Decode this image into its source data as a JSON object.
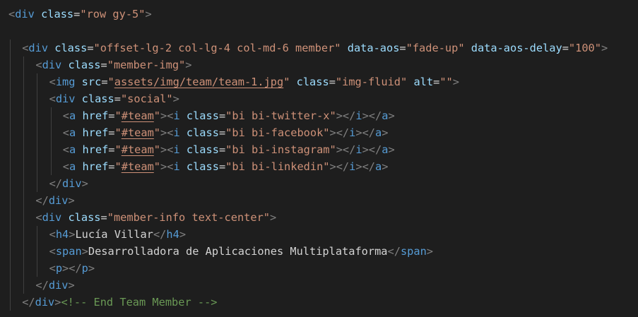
{
  "editor": {
    "theme": {
      "background": "#1e1e1e",
      "tag": "#569cd6",
      "bracket": "#808080",
      "attribute": "#9cdcfe",
      "string": "#ce9178",
      "text": "#d4d4d4",
      "comment": "#6a9955",
      "indent_guide": "#404040"
    },
    "lines": [
      {
        "indent": 0,
        "tokens": [
          {
            "t": "punc",
            "v": "<"
          },
          {
            "t": "tag",
            "v": "div"
          },
          {
            "t": "text",
            "v": " "
          },
          {
            "t": "attr",
            "v": "class"
          },
          {
            "t": "text",
            "v": "="
          },
          {
            "t": "str",
            "v": "\"row gy-5\""
          },
          {
            "t": "punc",
            "v": ">"
          }
        ]
      },
      {
        "indent": 0,
        "tokens": []
      },
      {
        "indent": 1,
        "tokens": [
          {
            "t": "punc",
            "v": "<"
          },
          {
            "t": "tag",
            "v": "div"
          },
          {
            "t": "text",
            "v": " "
          },
          {
            "t": "attr",
            "v": "class"
          },
          {
            "t": "text",
            "v": "="
          },
          {
            "t": "str",
            "v": "\"offset-lg-2 col-lg-4 col-md-6 member\""
          },
          {
            "t": "text",
            "v": " "
          },
          {
            "t": "attr",
            "v": "data-aos"
          },
          {
            "t": "text",
            "v": "="
          },
          {
            "t": "str",
            "v": "\"fade-up\""
          },
          {
            "t": "text",
            "v": " "
          },
          {
            "t": "attr",
            "v": "data-aos-delay"
          },
          {
            "t": "text",
            "v": "="
          },
          {
            "t": "str",
            "v": "\"100\""
          },
          {
            "t": "punc",
            "v": ">"
          }
        ]
      },
      {
        "indent": 2,
        "tokens": [
          {
            "t": "punc",
            "v": "<"
          },
          {
            "t": "tag",
            "v": "div"
          },
          {
            "t": "text",
            "v": " "
          },
          {
            "t": "attr",
            "v": "class"
          },
          {
            "t": "text",
            "v": "="
          },
          {
            "t": "str",
            "v": "\"member-img\""
          },
          {
            "t": "punc",
            "v": ">"
          }
        ]
      },
      {
        "indent": 3,
        "tokens": [
          {
            "t": "punc",
            "v": "<"
          },
          {
            "t": "tag",
            "v": "img"
          },
          {
            "t": "text",
            "v": " "
          },
          {
            "t": "attr",
            "v": "src"
          },
          {
            "t": "text",
            "v": "="
          },
          {
            "t": "str",
            "v": "\""
          },
          {
            "t": "str",
            "v": "assets/img/team/team-1.jpg",
            "link": true
          },
          {
            "t": "str",
            "v": "\""
          },
          {
            "t": "text",
            "v": " "
          },
          {
            "t": "attr",
            "v": "class"
          },
          {
            "t": "text",
            "v": "="
          },
          {
            "t": "str",
            "v": "\"img-fluid\""
          },
          {
            "t": "text",
            "v": " "
          },
          {
            "t": "attr",
            "v": "alt"
          },
          {
            "t": "text",
            "v": "="
          },
          {
            "t": "str",
            "v": "\"\""
          },
          {
            "t": "punc",
            "v": ">"
          }
        ]
      },
      {
        "indent": 3,
        "tokens": [
          {
            "t": "punc",
            "v": "<"
          },
          {
            "t": "tag",
            "v": "div"
          },
          {
            "t": "text",
            "v": " "
          },
          {
            "t": "attr",
            "v": "class"
          },
          {
            "t": "text",
            "v": "="
          },
          {
            "t": "str",
            "v": "\"social\""
          },
          {
            "t": "punc",
            "v": ">"
          }
        ]
      },
      {
        "indent": 4,
        "tokens": [
          {
            "t": "punc",
            "v": "<"
          },
          {
            "t": "tag",
            "v": "a"
          },
          {
            "t": "text",
            "v": " "
          },
          {
            "t": "attr",
            "v": "href"
          },
          {
            "t": "text",
            "v": "="
          },
          {
            "t": "str",
            "v": "\""
          },
          {
            "t": "str",
            "v": "#team",
            "link": true
          },
          {
            "t": "str",
            "v": "\""
          },
          {
            "t": "punc",
            "v": "><"
          },
          {
            "t": "tag",
            "v": "i"
          },
          {
            "t": "text",
            "v": " "
          },
          {
            "t": "attr",
            "v": "class"
          },
          {
            "t": "text",
            "v": "="
          },
          {
            "t": "str",
            "v": "\"bi bi-twitter-x\""
          },
          {
            "t": "punc",
            "v": "></"
          },
          {
            "t": "tag",
            "v": "i"
          },
          {
            "t": "punc",
            "v": "></"
          },
          {
            "t": "tag",
            "v": "a"
          },
          {
            "t": "punc",
            "v": ">"
          }
        ]
      },
      {
        "indent": 4,
        "tokens": [
          {
            "t": "punc",
            "v": "<"
          },
          {
            "t": "tag",
            "v": "a"
          },
          {
            "t": "text",
            "v": " "
          },
          {
            "t": "attr",
            "v": "href"
          },
          {
            "t": "text",
            "v": "="
          },
          {
            "t": "str",
            "v": "\""
          },
          {
            "t": "str",
            "v": "#team",
            "link": true
          },
          {
            "t": "str",
            "v": "\""
          },
          {
            "t": "punc",
            "v": "><"
          },
          {
            "t": "tag",
            "v": "i"
          },
          {
            "t": "text",
            "v": " "
          },
          {
            "t": "attr",
            "v": "class"
          },
          {
            "t": "text",
            "v": "="
          },
          {
            "t": "str",
            "v": "\"bi bi-facebook\""
          },
          {
            "t": "punc",
            "v": "></"
          },
          {
            "t": "tag",
            "v": "i"
          },
          {
            "t": "punc",
            "v": "></"
          },
          {
            "t": "tag",
            "v": "a"
          },
          {
            "t": "punc",
            "v": ">"
          }
        ]
      },
      {
        "indent": 4,
        "tokens": [
          {
            "t": "punc",
            "v": "<"
          },
          {
            "t": "tag",
            "v": "a"
          },
          {
            "t": "text",
            "v": " "
          },
          {
            "t": "attr",
            "v": "href"
          },
          {
            "t": "text",
            "v": "="
          },
          {
            "t": "str",
            "v": "\""
          },
          {
            "t": "str",
            "v": "#team",
            "link": true
          },
          {
            "t": "str",
            "v": "\""
          },
          {
            "t": "punc",
            "v": "><"
          },
          {
            "t": "tag",
            "v": "i"
          },
          {
            "t": "text",
            "v": " "
          },
          {
            "t": "attr",
            "v": "class"
          },
          {
            "t": "text",
            "v": "="
          },
          {
            "t": "str",
            "v": "\"bi bi-instagram\""
          },
          {
            "t": "punc",
            "v": "></"
          },
          {
            "t": "tag",
            "v": "i"
          },
          {
            "t": "punc",
            "v": "></"
          },
          {
            "t": "tag",
            "v": "a"
          },
          {
            "t": "punc",
            "v": ">"
          }
        ]
      },
      {
        "indent": 4,
        "tokens": [
          {
            "t": "punc",
            "v": "<"
          },
          {
            "t": "tag",
            "v": "a"
          },
          {
            "t": "text",
            "v": " "
          },
          {
            "t": "attr",
            "v": "href"
          },
          {
            "t": "text",
            "v": "="
          },
          {
            "t": "str",
            "v": "\""
          },
          {
            "t": "str",
            "v": "#team",
            "link": true
          },
          {
            "t": "str",
            "v": "\""
          },
          {
            "t": "punc",
            "v": "><"
          },
          {
            "t": "tag",
            "v": "i"
          },
          {
            "t": "text",
            "v": " "
          },
          {
            "t": "attr",
            "v": "class"
          },
          {
            "t": "text",
            "v": "="
          },
          {
            "t": "str",
            "v": "\"bi bi-linkedin\""
          },
          {
            "t": "punc",
            "v": "></"
          },
          {
            "t": "tag",
            "v": "i"
          },
          {
            "t": "punc",
            "v": "></"
          },
          {
            "t": "tag",
            "v": "a"
          },
          {
            "t": "punc",
            "v": ">"
          }
        ]
      },
      {
        "indent": 3,
        "tokens": [
          {
            "t": "punc",
            "v": "</"
          },
          {
            "t": "tag",
            "v": "div"
          },
          {
            "t": "punc",
            "v": ">"
          }
        ]
      },
      {
        "indent": 2,
        "tokens": [
          {
            "t": "punc",
            "v": "</"
          },
          {
            "t": "tag",
            "v": "div"
          },
          {
            "t": "punc",
            "v": ">"
          }
        ]
      },
      {
        "indent": 2,
        "tokens": [
          {
            "t": "punc",
            "v": "<"
          },
          {
            "t": "tag",
            "v": "div"
          },
          {
            "t": "text",
            "v": " "
          },
          {
            "t": "attr",
            "v": "class"
          },
          {
            "t": "text",
            "v": "="
          },
          {
            "t": "str",
            "v": "\"member-info text-center\""
          },
          {
            "t": "punc",
            "v": ">"
          }
        ]
      },
      {
        "indent": 3,
        "tokens": [
          {
            "t": "punc",
            "v": "<"
          },
          {
            "t": "tag",
            "v": "h4"
          },
          {
            "t": "punc",
            "v": ">"
          },
          {
            "t": "text",
            "v": "Lucía Villar"
          },
          {
            "t": "punc",
            "v": "</"
          },
          {
            "t": "tag",
            "v": "h4"
          },
          {
            "t": "punc",
            "v": ">"
          }
        ]
      },
      {
        "indent": 3,
        "tokens": [
          {
            "t": "punc",
            "v": "<"
          },
          {
            "t": "tag",
            "v": "span"
          },
          {
            "t": "punc",
            "v": ">"
          },
          {
            "t": "text",
            "v": "Desarrolladora de Aplicaciones Multiplataforma"
          },
          {
            "t": "punc",
            "v": "</"
          },
          {
            "t": "tag",
            "v": "span"
          },
          {
            "t": "punc",
            "v": ">"
          }
        ]
      },
      {
        "indent": 3,
        "tokens": [
          {
            "t": "punc",
            "v": "<"
          },
          {
            "t": "tag",
            "v": "p"
          },
          {
            "t": "punc",
            "v": "></"
          },
          {
            "t": "tag",
            "v": "p"
          },
          {
            "t": "punc",
            "v": ">"
          }
        ]
      },
      {
        "indent": 2,
        "tokens": [
          {
            "t": "punc",
            "v": "</"
          },
          {
            "t": "tag",
            "v": "div"
          },
          {
            "t": "punc",
            "v": ">"
          }
        ]
      },
      {
        "indent": 1,
        "tokens": [
          {
            "t": "punc",
            "v": "</"
          },
          {
            "t": "tag",
            "v": "div"
          },
          {
            "t": "punc",
            "v": ">"
          },
          {
            "t": "comment",
            "v": "<!-- End Team Member -->"
          }
        ]
      }
    ]
  }
}
